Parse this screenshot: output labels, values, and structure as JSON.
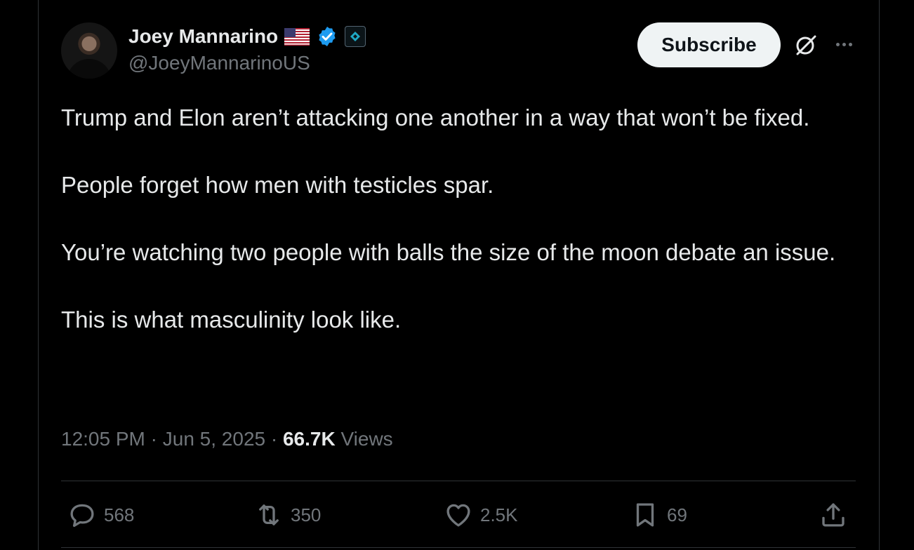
{
  "author": {
    "name": "Joey Mannarino",
    "handle": "@JoeyMannarinoUS"
  },
  "header": {
    "subscribe_label": "Subscribe"
  },
  "tweet": {
    "paragraphs": [
      "Trump and Elon aren’t attacking one another in a way that won’t be fixed.",
      "People forget how men with testicles spar.",
      "You’re watching two people with balls the size of the moon debate an issue.",
      "This is what masculinity look like."
    ],
    "time": "12:05 PM",
    "date": "Jun 5, 2025",
    "separator": "·",
    "views_count": "66.7K",
    "views_label": "Views"
  },
  "actions": {
    "replies": "568",
    "reposts": "350",
    "likes": "2.5K",
    "bookmarks": "69"
  },
  "colors": {
    "background": "#000000",
    "text": "#e7e9ea",
    "muted": "#71767b",
    "verified": "#1d9bf0",
    "border": "#2f3336"
  },
  "icons": [
    "us-flag-icon",
    "verified-badge-icon",
    "affiliate-badge-icon",
    "grok-icon",
    "more-icon",
    "reply-icon",
    "repost-icon",
    "like-icon",
    "bookmark-icon",
    "share-icon"
  ]
}
